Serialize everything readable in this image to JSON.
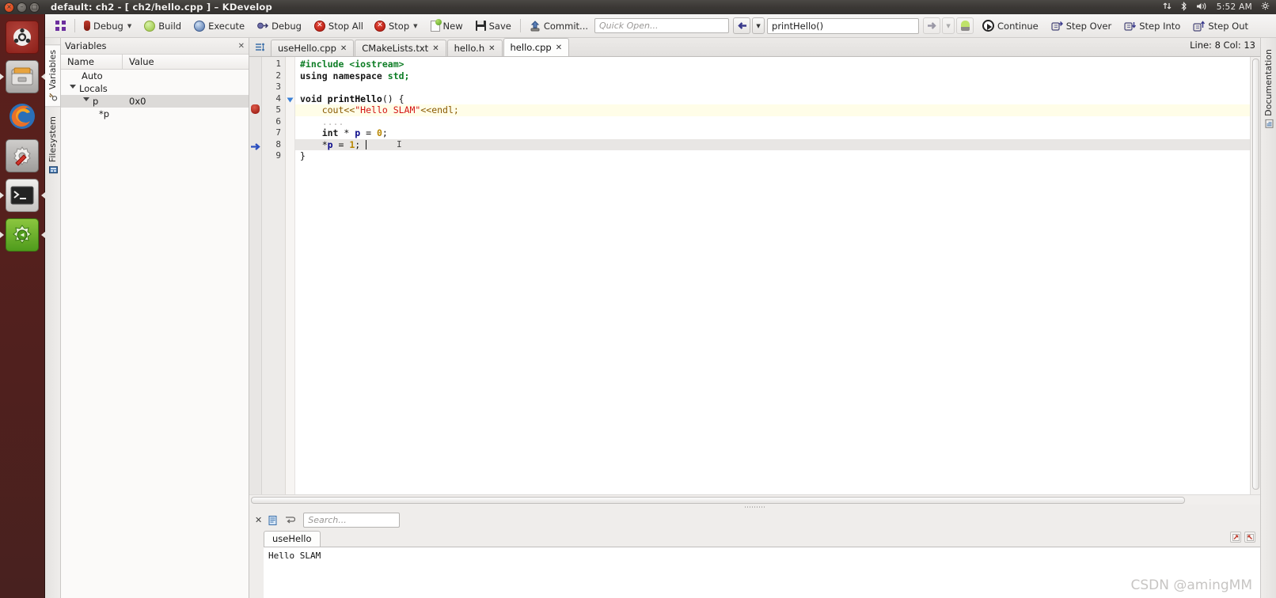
{
  "titlebar": {
    "title": "default: ch2 - [ ch2/hello.cpp ] – KDevelop",
    "buttons": [
      {
        "name": "close",
        "glyph": "×"
      },
      {
        "name": "minimize",
        "glyph": "–"
      },
      {
        "name": "maximize",
        "glyph": "□"
      }
    ],
    "tray": {
      "network_icon": "↑↓",
      "bluetooth_icon": "✳",
      "volume_icon": "🔊",
      "clock": "5:52 AM",
      "gear_icon": "⚙"
    }
  },
  "launcher": {
    "items": [
      {
        "name": "ubuntu-dash-icon",
        "label": "Ubuntu Dash",
        "selected": false
      },
      {
        "name": "files-icon",
        "label": "Files",
        "selected": true
      },
      {
        "name": "firefox-icon",
        "label": "Firefox",
        "selected": false
      },
      {
        "name": "settings-icon",
        "label": "System Settings",
        "selected": false
      },
      {
        "name": "terminal-icon",
        "label": "Terminal",
        "selected": true
      },
      {
        "name": "kdevelop-icon",
        "label": "KDevelop",
        "selected": true
      }
    ]
  },
  "toolbar": {
    "grid_label": "",
    "items": [
      {
        "label": "Debug",
        "icon": "debug-profile-icon",
        "caret": true
      },
      {
        "label": "Build",
        "icon": "build-icon",
        "caret": false
      },
      {
        "label": "Execute",
        "icon": "execute-icon",
        "caret": false
      },
      {
        "label": "Debug",
        "icon": "debug-run-icon",
        "caret": false
      },
      {
        "label": "Stop All",
        "icon": "stop-all-icon",
        "caret": false
      },
      {
        "label": "Stop",
        "icon": "stop-icon",
        "caret": true
      },
      {
        "label": "New",
        "icon": "new-file-icon",
        "caret": false
      },
      {
        "label": "Save",
        "icon": "save-icon",
        "caret": false
      },
      {
        "label": "Commit...",
        "icon": "commit-icon",
        "caret": false
      }
    ],
    "quick_open_placeholder": "Quick Open...",
    "quick_open_value": "",
    "function_box_value": "printHello()",
    "nav_back_icon": "◀",
    "nav_back_caret": "▾",
    "nav_fwd_icon": "▶",
    "nav_fwd_caret": "▾",
    "bulb_icon": "💡",
    "debug_items": [
      {
        "label": "Continue",
        "icon": "continue-icon"
      },
      {
        "label": "Step Over",
        "icon": "step-over-icon"
      },
      {
        "label": "Step Into",
        "icon": "step-into-icon"
      },
      {
        "label": "Step Out",
        "icon": "step-out-icon"
      }
    ]
  },
  "status": {
    "cursor": "Line: 8 Col: 13"
  },
  "left_vtabs": [
    {
      "label": "Variables",
      "icon": "variables-icon",
      "active": true
    },
    {
      "label": "Filesystem",
      "icon": "filesystem-icon",
      "active": false
    }
  ],
  "right_vtabs": [
    {
      "label": "Documentation",
      "icon": "documentation-icon",
      "active": false
    }
  ],
  "variables_panel": {
    "title": "Variables",
    "close_glyph": "✕",
    "columns": [
      "Name",
      "Value"
    ],
    "rows": [
      {
        "indent": 1,
        "expander": "none",
        "name": "Auto",
        "value": ""
      },
      {
        "indent": 0,
        "expander": "down",
        "name": "Locals",
        "value": ""
      },
      {
        "indent": 1,
        "expander": "down",
        "name": "p",
        "value": "0x0",
        "highlight": true
      },
      {
        "indent": 2,
        "expander": "none",
        "name": "*p",
        "value": ""
      }
    ]
  },
  "editor": {
    "tabs": [
      {
        "label": "useHello.cpp",
        "close": "✕",
        "active": false
      },
      {
        "label": "CMakeLists.txt",
        "close": "✕",
        "active": false
      },
      {
        "label": "hello.h",
        "close": "✕",
        "active": false
      },
      {
        "label": "hello.cpp",
        "close": "✕",
        "active": true
      }
    ],
    "line_numbers": [
      "1",
      "2",
      "3",
      "4",
      "5",
      "6",
      "7",
      "8",
      "9"
    ],
    "breakpoint_line": 5,
    "exec_pointer_line": 8,
    "fold_marker_line": 4,
    "current_line": 5,
    "exec_line_highlight": 8,
    "lines": [
      {
        "n": 1,
        "tokens": [
          {
            "t": "#include <iostream>",
            "c": "k-prep"
          }
        ]
      },
      {
        "n": 2,
        "tokens": [
          {
            "t": "using namespace ",
            "c": "k-kw"
          },
          {
            "t": "std;",
            "c": "k-ns"
          }
        ]
      },
      {
        "n": 3,
        "tokens": [
          {
            "t": "",
            "c": "k-plain"
          }
        ]
      },
      {
        "n": 4,
        "tokens": [
          {
            "t": "void ",
            "c": "k-type"
          },
          {
            "t": "printHello",
            "c": "k-fn"
          },
          {
            "t": "() {",
            "c": "k-plain"
          }
        ]
      },
      {
        "n": 5,
        "tokens": [
          {
            "t": "    ",
            "c": "k-plain"
          },
          {
            "t": "cout<<",
            "c": "k-op"
          },
          {
            "t": "\"Hello SLAM\"",
            "c": "k-str"
          },
          {
            "t": "<<endl;",
            "c": "k-op"
          }
        ]
      },
      {
        "n": 6,
        "tokens": [
          {
            "t": "    ....",
            "c": "k-dots"
          }
        ]
      },
      {
        "n": 7,
        "tokens": [
          {
            "t": "    ",
            "c": "k-plain"
          },
          {
            "t": "int ",
            "c": "k-type"
          },
          {
            "t": "* ",
            "c": "k-plain"
          },
          {
            "t": "p ",
            "c": "k-var"
          },
          {
            "t": "= ",
            "c": "k-plain"
          },
          {
            "t": "0",
            "c": "k-num"
          },
          {
            "t": ";",
            "c": "k-plain"
          }
        ]
      },
      {
        "n": 8,
        "tokens": [
          {
            "t": "    *",
            "c": "k-plain"
          },
          {
            "t": "p ",
            "c": "k-var"
          },
          {
            "t": "= ",
            "c": "k-plain"
          },
          {
            "t": "1",
            "c": "k-num"
          },
          {
            "t": "; ",
            "c": "k-plain"
          }
        ]
      },
      {
        "n": 9,
        "tokens": [
          {
            "t": "}",
            "c": "k-plain"
          }
        ]
      }
    ]
  },
  "bottom_panel": {
    "close_glyph": "✕",
    "list_icon": "list-view-icon",
    "wrap_icon": "word-wrap-icon",
    "search_placeholder": "Search...",
    "search_value": "",
    "tabs": [
      {
        "label": "useHello",
        "active": true
      }
    ],
    "console_output": "Hello SLAM",
    "right_buttons": [
      {
        "name": "detach-button",
        "glyph": "⬒"
      },
      {
        "name": "close-panel-button",
        "glyph": "⬓"
      }
    ]
  },
  "watermark": "CSDN @amingMM"
}
